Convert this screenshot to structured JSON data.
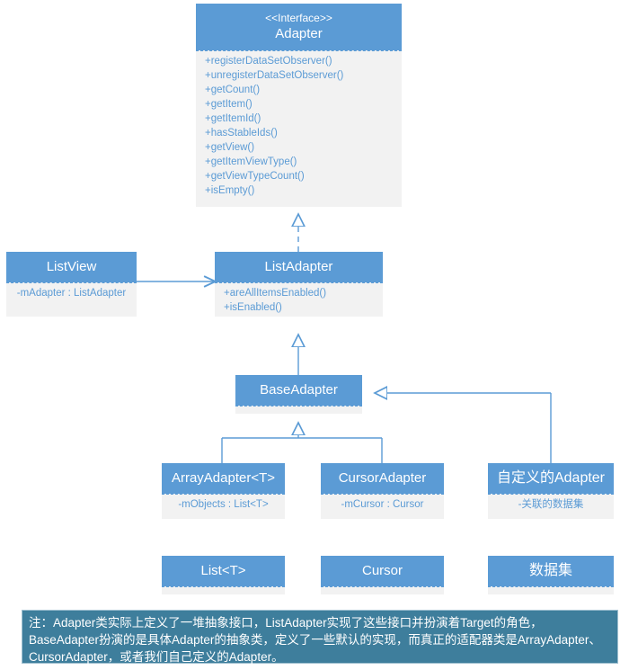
{
  "diagram": {
    "title": "Android Adapter UML class diagram",
    "accent_color": "#5B9BD5",
    "compartment_color": "#F2F2F2",
    "note_color": "#3E7E9C"
  },
  "classes": {
    "adapter": {
      "stereotype": "<<Interface>>",
      "name": "Adapter",
      "members": [
        "+registerDataSetObserver()",
        "+unregisterDataSetObserver()",
        "+getCount()",
        "+getItem()",
        "+getItemId()",
        "+hasStableIds()",
        "+getView()",
        "+getItemViewType()",
        "+getViewTypeCount()",
        "+isEmpty()"
      ]
    },
    "listview": {
      "name": "ListView",
      "members": [
        "-mAdapter : ListAdapter"
      ]
    },
    "listadapter": {
      "name": "ListAdapter",
      "members": [
        "+areAllItemsEnabled()",
        "+isEnabled()"
      ]
    },
    "baseadapter": {
      "name": "BaseAdapter",
      "members": []
    },
    "arrayadapter": {
      "name": "ArrayAdapter<T>",
      "members": [
        "-mObjects : List<T>"
      ]
    },
    "cursoradapter": {
      "name": "CursorAdapter",
      "members": [
        "-mCursor : Cursor"
      ]
    },
    "customadapter": {
      "name": "自定义的Adapter",
      "members": [
        "-关联的数据集"
      ]
    },
    "listt": {
      "name": "List<T>",
      "members": []
    },
    "cursor": {
      "name": "Cursor",
      "members": []
    },
    "dataset": {
      "name": "数据集",
      "members": []
    }
  },
  "note": {
    "text": "注：Adapter类实际上定义了一堆抽象接口，ListAdapter实现了这些接口并扮演着Target的角色，BaseAdapter扮演的是具体Adapter的抽象类，定义了一些默认的实现，而真正的适配器类是ArrayAdapter、CursorAdapter，或者我们自己定义的Adapter。"
  }
}
